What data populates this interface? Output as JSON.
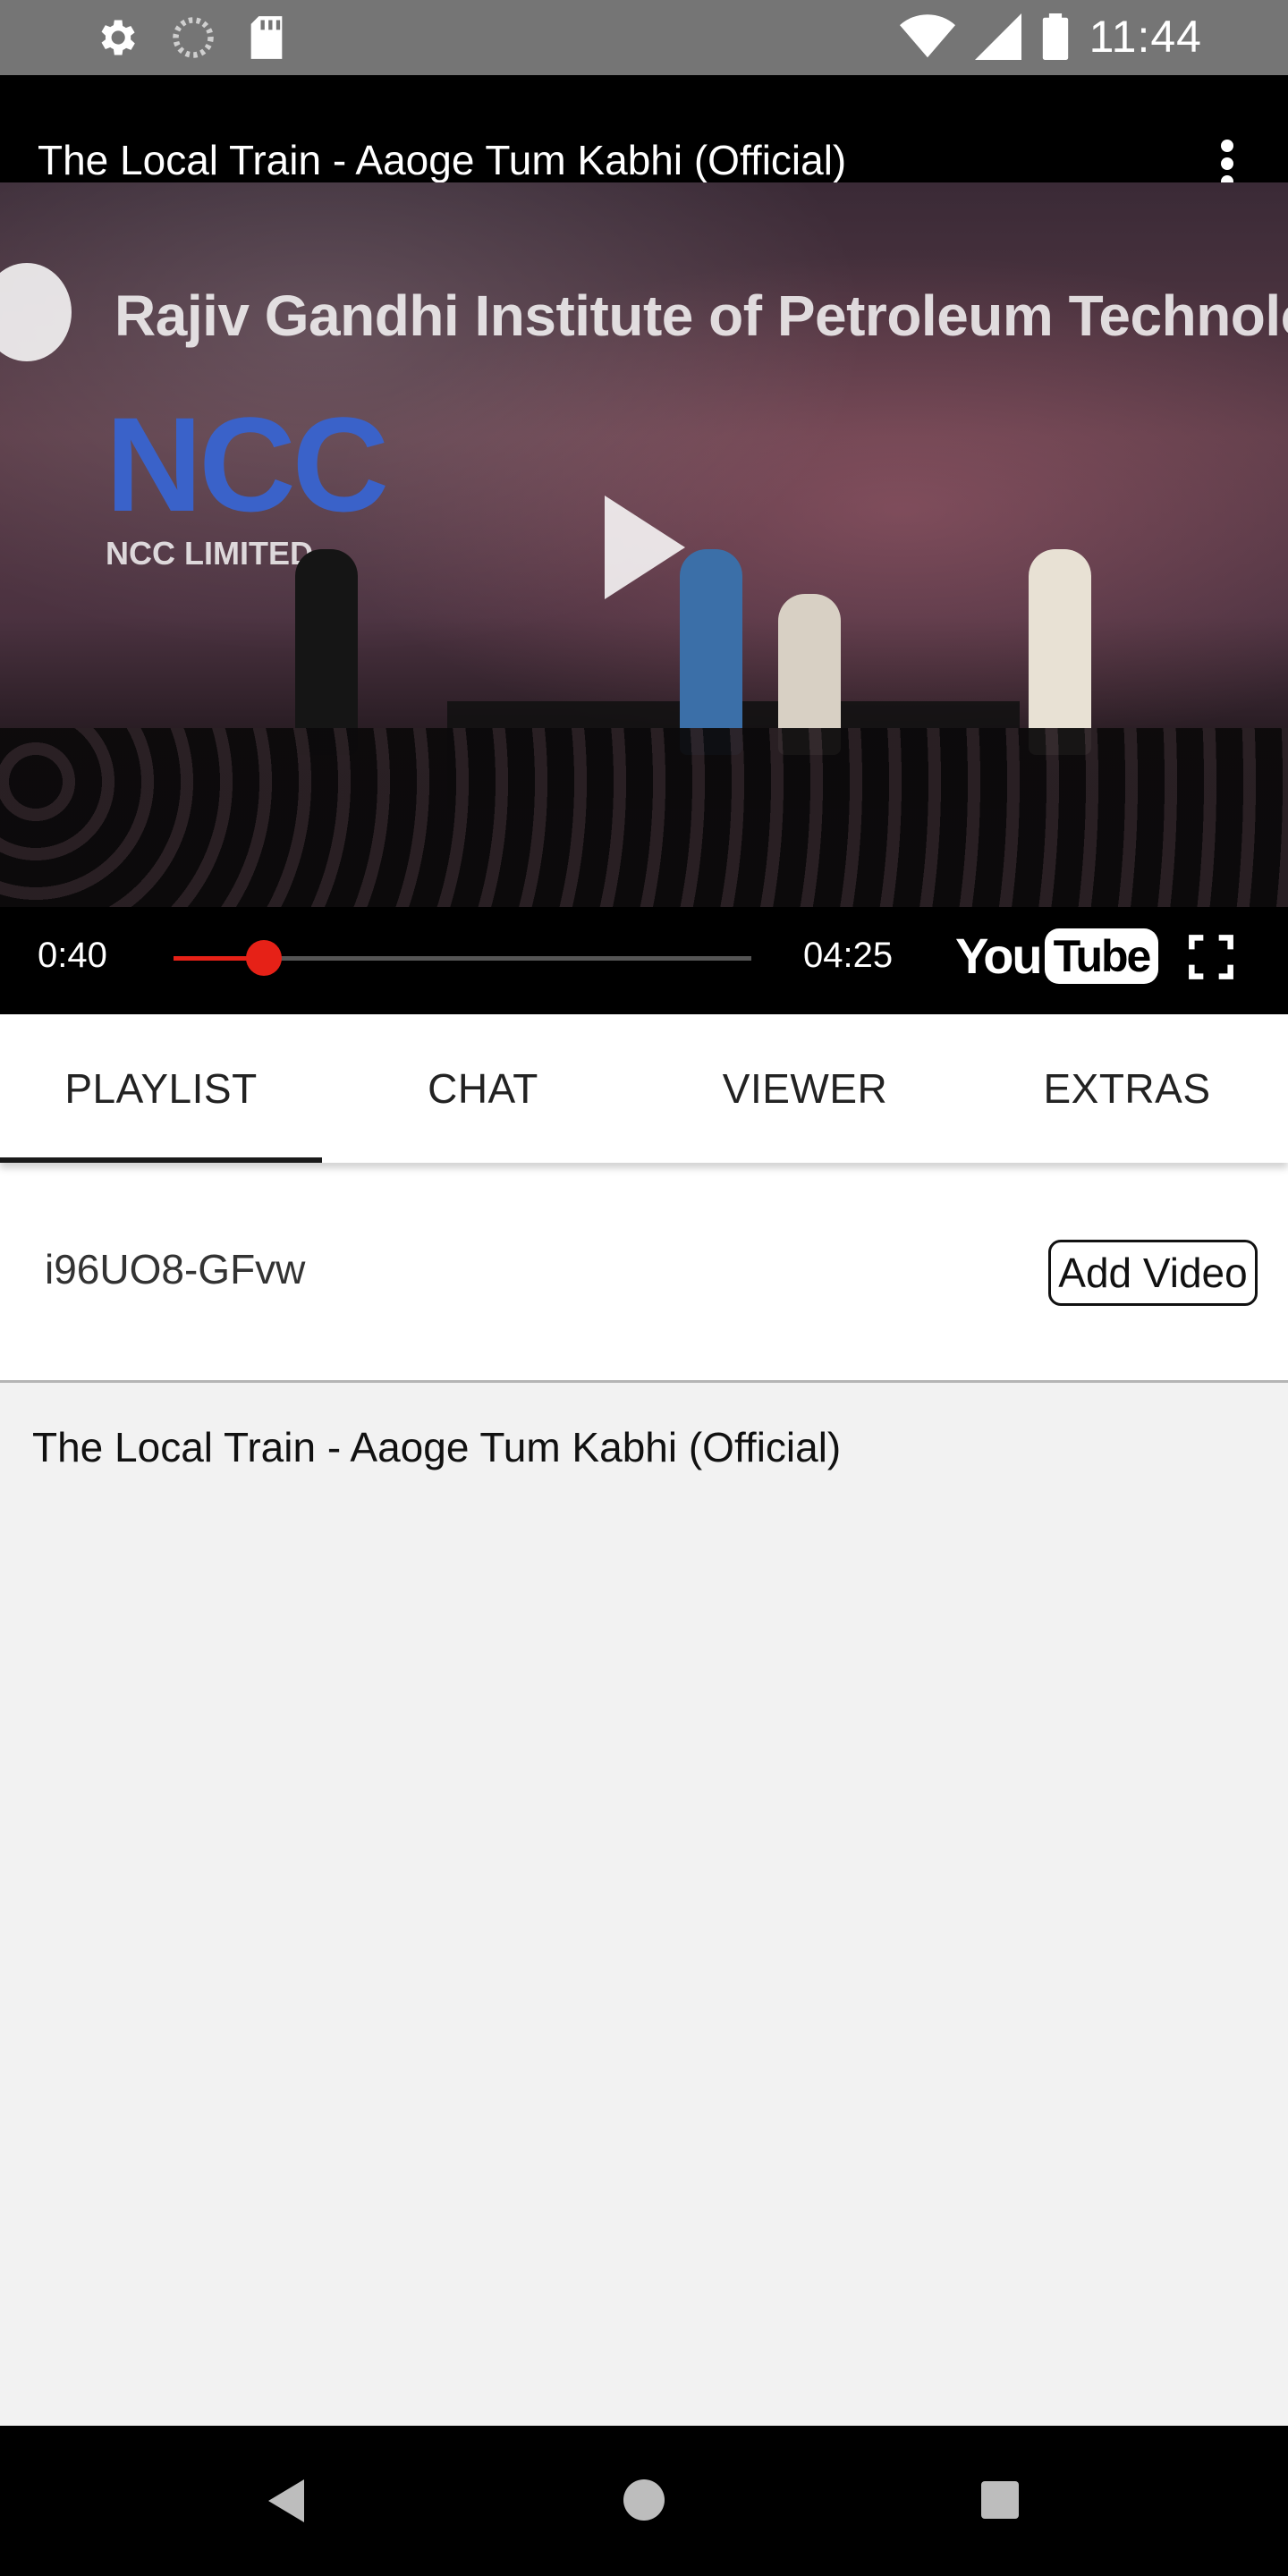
{
  "status_bar": {
    "time": "11:44",
    "left_icons": [
      "settings-icon",
      "sync-icon",
      "sd-card-icon"
    ],
    "right_icons": [
      "wifi-icon",
      "signal-icon",
      "battery-icon"
    ]
  },
  "player": {
    "title": "The Local Train - Aaoge Tum Kabhi (Official)",
    "banner_text": "Rajiv Gandhi Institute of Petroleum Technology",
    "logo_big": "NCC",
    "logo_small": "NCC LIMITED",
    "current_time": "0:40",
    "total_time": "04:25",
    "progress_fraction": 0.157,
    "brand_you": "You",
    "brand_tube": "Tube",
    "accent_color": "#e62117"
  },
  "tabs": [
    {
      "label": "PLAYLIST",
      "active": true
    },
    {
      "label": "CHAT",
      "active": false
    },
    {
      "label": "VIEWER",
      "active": false
    },
    {
      "label": "EXTRAS",
      "active": false
    }
  ],
  "add_video": {
    "input_value": "i96UO8-GFvw",
    "button_label": "Add Video"
  },
  "playlist": {
    "items": [
      {
        "title": "The Local Train - Aaoge Tum Kabhi (Official)"
      }
    ]
  },
  "nav_bar": {
    "icons": [
      "back-icon",
      "home-icon",
      "recents-icon"
    ]
  }
}
